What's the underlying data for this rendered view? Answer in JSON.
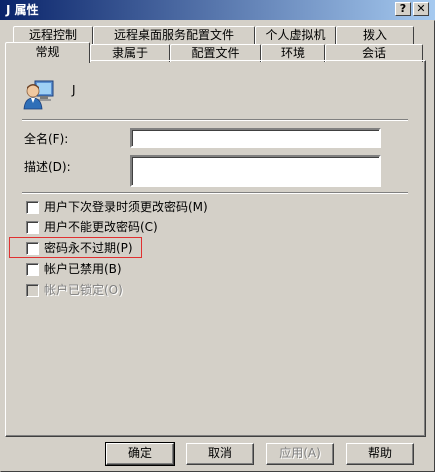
{
  "window": {
    "title": "J 属性",
    "help_button": "?",
    "close_button": "✕"
  },
  "tabs_back": [
    "远程控制",
    "远程桌面服务配置文件",
    "个人虚拟机",
    "拨入"
  ],
  "tabs_front": [
    "常规",
    "隶属于",
    "配置文件",
    "环境",
    "会话"
  ],
  "active_tab": "常规",
  "user": {
    "name": "J",
    "icon": "user-icon"
  },
  "form": {
    "fullname_label": "全名(F):",
    "fullname_value": "",
    "description_label": "描述(D):",
    "description_value": ""
  },
  "checkboxes": [
    {
      "label": "用户下次登录时须更改密码(M)",
      "checked": false,
      "enabled": true
    },
    {
      "label": "用户不能更改密码(C)",
      "checked": false,
      "enabled": true
    },
    {
      "label": "密码永不过期(P)",
      "checked": false,
      "enabled": true
    },
    {
      "label": "帐户已禁用(B)",
      "checked": false,
      "enabled": true
    },
    {
      "label": "帐户已锁定(O)",
      "checked": false,
      "enabled": false
    }
  ],
  "buttons": {
    "ok": "确定",
    "cancel": "取消",
    "apply": "应用(A)",
    "help": "帮助"
  },
  "colors": {
    "face": "#d4d0c8",
    "titlebar_start": "#0a246a",
    "titlebar_end": "#a6caf0",
    "highlight_border": "#e03030"
  }
}
